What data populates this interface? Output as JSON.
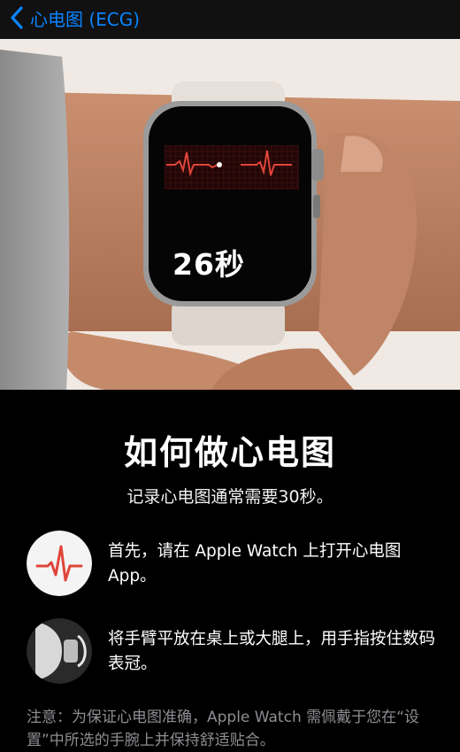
{
  "nav": {
    "back_label": "心电图 (ECG)",
    "back_icon": "chevron-left-icon",
    "accent": "#0a84ff"
  },
  "hero": {
    "watch_timer": "26秒",
    "ecg_color": "#e0453a"
  },
  "main": {
    "title": "如何做心电图",
    "subtitle": "记录心电图通常需要30秒。",
    "steps": [
      {
        "icon": "ecg-app-icon",
        "text": "首先，请在 Apple Watch 上打开心电图 App。"
      },
      {
        "icon": "digital-crown-icon",
        "text": "将手臂平放在桌上或大腿上，用手指按住数码表冠。"
      }
    ],
    "note": "注意：为保证心电图准确，Apple Watch 需佩戴于您在“设置”中所选的手腕上并保持舒适贴合。"
  }
}
